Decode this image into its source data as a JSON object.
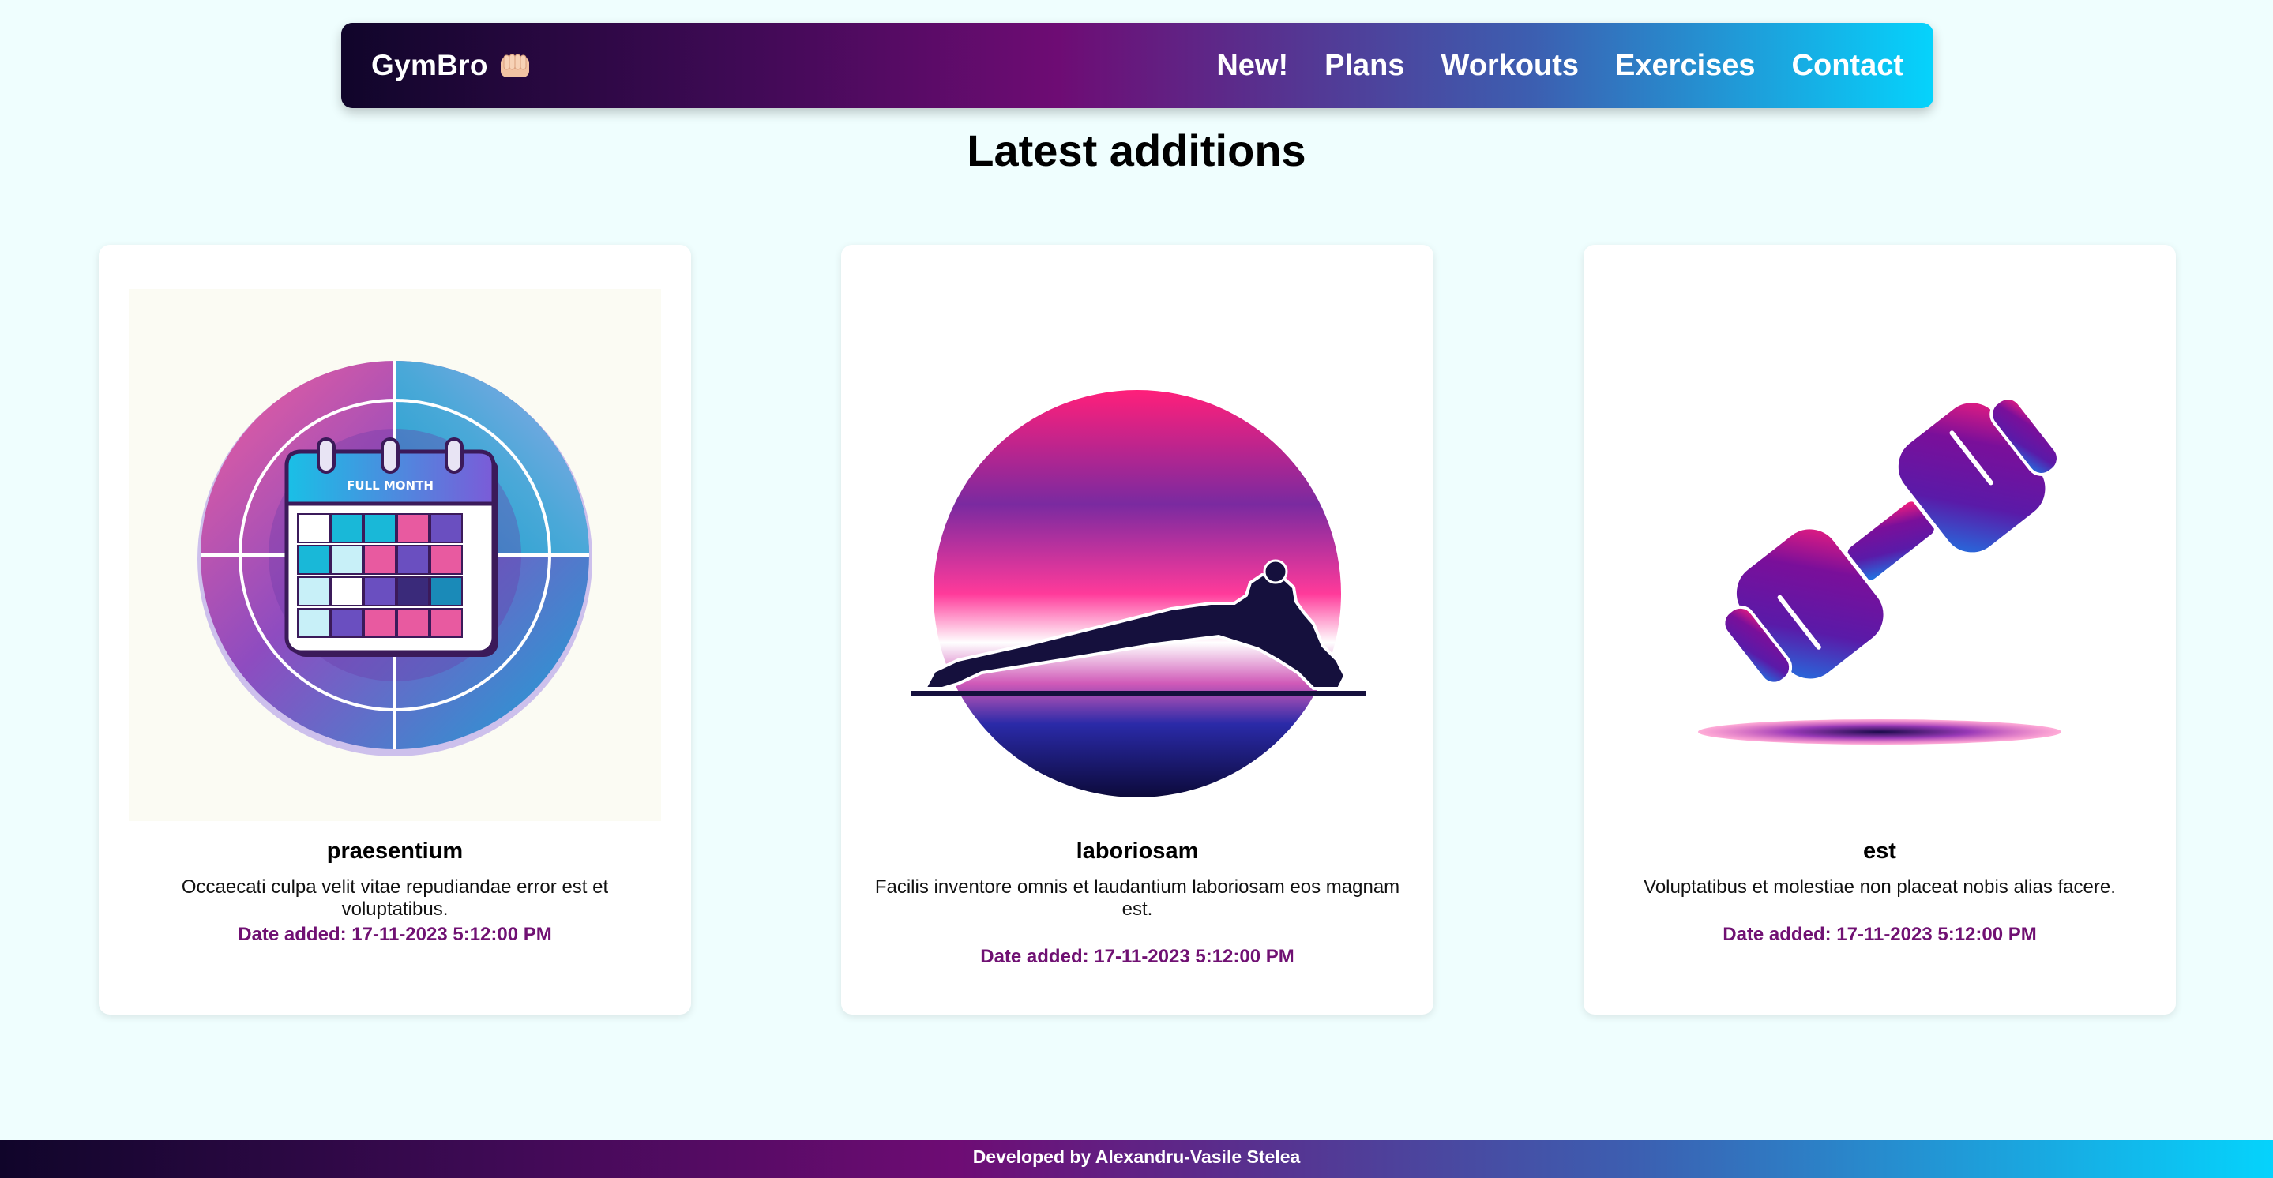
{
  "nav": {
    "brand": "GymBro",
    "brand_icon": "fist-icon",
    "links": [
      "New!",
      "Plans",
      "Workouts",
      "Exercises",
      "Contact"
    ]
  },
  "page_title": "Latest additions",
  "cards": [
    {
      "image_icon": "calendar-icon",
      "title": "praesentium",
      "description": "Occaecati culpa velit vitae repudiandae error est et voluptatibus.",
      "date": "Date added: 17-11-2023 5:12:00 PM",
      "image_text": "FULL MONTH"
    },
    {
      "image_icon": "plank-silhouette-icon",
      "title": "laboriosam",
      "description": "Facilis inventore omnis et laudantium laboriosam eos magnam est.",
      "date": "Date added: 17-11-2023 5:12:00 PM"
    },
    {
      "image_icon": "dumbbell-icon",
      "title": "est",
      "description": "Voluptatibus et molestiae non placeat nobis alias facere.",
      "date": "Date added: 17-11-2023 5:12:00 PM"
    }
  ],
  "footer": {
    "text": "Developed by Alexandru-Vasile Stelea"
  },
  "colors": {
    "background": "#effefe",
    "accent_date": "#701173",
    "gradient_start": "#10052a",
    "gradient_mid": "#6e0c74",
    "gradient_end": "#05d3fc"
  }
}
